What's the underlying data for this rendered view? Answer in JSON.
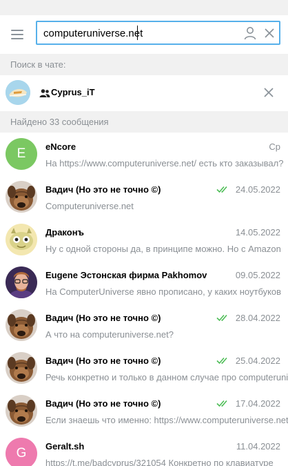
{
  "search": {
    "query": "computeruniverse.net"
  },
  "labels": {
    "search_in_chat": "Поиск в чате:",
    "found": "Найдено 33 сообщения"
  },
  "chat": {
    "name": "Cyprus_iT"
  },
  "colors": {
    "accent": "#56b0ea",
    "check": "#4dbd56",
    "avatar_green": "#7bc862",
    "avatar_pink": "#ee7aae"
  },
  "results": [
    {
      "name": "eNcore",
      "date": "Ср",
      "read": false,
      "preview": "На  https://www.computeruniverse.net/ есть кто заказывал?",
      "avatar": "letter",
      "letter": "E"
    },
    {
      "name": "Вадич (Но это не точно ©)",
      "date": "24.05.2022",
      "read": true,
      "preview": "Computeruniverse.net",
      "avatar": "dog"
    },
    {
      "name": "Драконъ",
      "date": "14.05.2022",
      "read": false,
      "preview": "Ну с одной стороны да, в принципе можно. Но с Amazon",
      "avatar": "toy"
    },
    {
      "name": "Eugene Эстонская фирма Pakhomov",
      "date": "09.05.2022",
      "read": false,
      "preview": "На ComputerUniverse явно прописано, у каких ноутбуков",
      "avatar": "person"
    },
    {
      "name": "Вадич (Но это не точно ©)",
      "date": "28.04.2022",
      "read": true,
      "preview": "А что на computeruniverse.net?",
      "avatar": "dog"
    },
    {
      "name": "Вадич (Но это не точно ©)",
      "date": "25.04.2022",
      "read": true,
      "preview": "Речь конкретно и только в данном случае про computeruniverse",
      "avatar": "dog"
    },
    {
      "name": "Вадич (Но это не точно ©)",
      "date": "17.04.2022",
      "read": true,
      "preview": "Если знаешь что именно:  https://www.computeruniverse.net",
      "avatar": "dog"
    },
    {
      "name": "Geralt.sh",
      "date": "11.04.2022",
      "read": false,
      "preview": "https://t.me/badcyprus/321054 Конкретно по клавиатуре",
      "avatar": "letter",
      "letter": "G"
    }
  ]
}
